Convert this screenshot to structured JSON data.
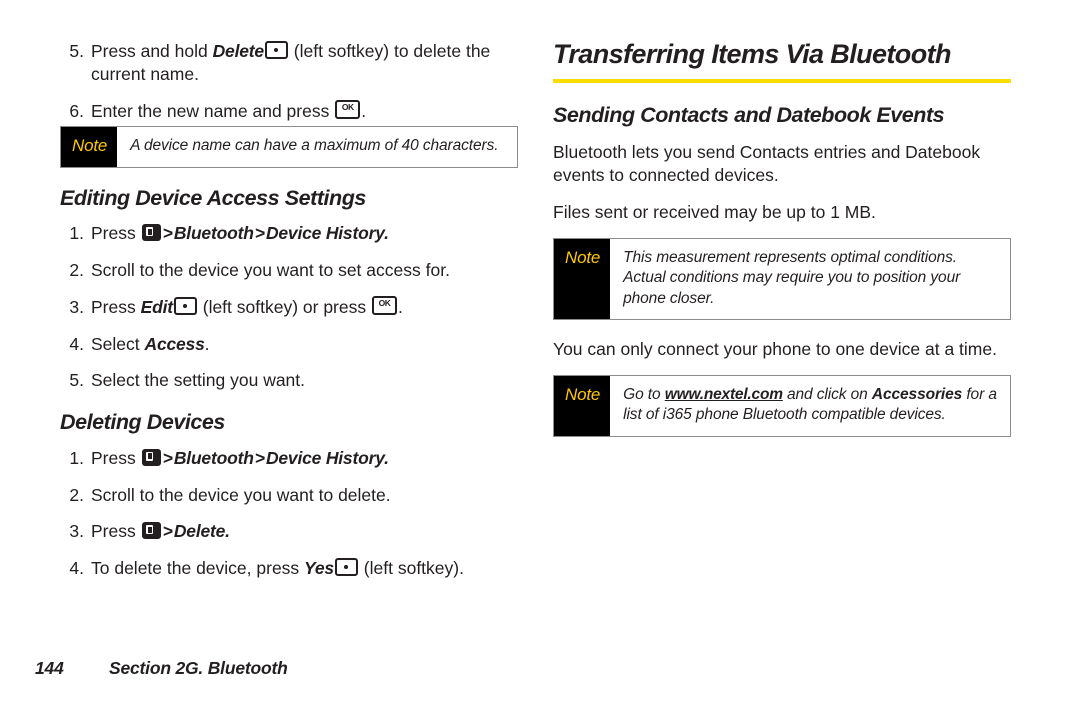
{
  "page": {
    "footer_page_number": "144",
    "footer_section": "Section 2G. Bluetooth"
  },
  "colors": {
    "accent_rule": "#FFDD00",
    "note_label_text": "#FFC800",
    "note_label_bg": "#000000",
    "body_text": "#231F20",
    "note_border": "#8C8C8C"
  },
  "icons": {
    "menu_key": "menu-key-icon",
    "ok_key": "ok-key-icon",
    "ok_key_label": "OK",
    "softkey": "left-softkey-icon"
  },
  "left_column": {
    "continued_steps": [
      {
        "number": "5.",
        "parts": [
          {
            "type": "text",
            "text": "Press and hold "
          },
          {
            "type": "bold-italic",
            "text": "Delete"
          },
          {
            "type": "icon",
            "icon": "softkey"
          },
          {
            "type": "text",
            "text": " (left softkey) to delete the current name."
          }
        ]
      },
      {
        "number": "6.",
        "parts": [
          {
            "type": "text",
            "text": "Enter the new name and press "
          },
          {
            "type": "icon",
            "icon": "ok_key"
          },
          {
            "type": "text",
            "text": "."
          }
        ]
      }
    ],
    "note_1": {
      "label": "Note",
      "text": "A device name can have a maximum of 40 characters."
    },
    "section_editing": {
      "heading": "Editing Device Access Settings",
      "steps": [
        {
          "number": "1.",
          "parts": [
            {
              "type": "text",
              "text": "Press "
            },
            {
              "type": "icon",
              "icon": "menu_key"
            },
            {
              "type": "sep",
              "text": ">"
            },
            {
              "type": "bold-italic",
              "text": "Bluetooth"
            },
            {
              "type": "sep",
              "text": ">"
            },
            {
              "type": "bold-italic",
              "text": "Device History."
            }
          ]
        },
        {
          "number": "2.",
          "parts": [
            {
              "type": "text",
              "text": "Scroll to the device you want to set access for."
            }
          ]
        },
        {
          "number": "3.",
          "parts": [
            {
              "type": "text",
              "text": "Press "
            },
            {
              "type": "bold-italic",
              "text": "Edit"
            },
            {
              "type": "icon",
              "icon": "softkey"
            },
            {
              "type": "text",
              "text": " (left softkey) or press "
            },
            {
              "type": "icon",
              "icon": "ok_key"
            },
            {
              "type": "text",
              "text": "."
            }
          ]
        },
        {
          "number": "4.",
          "parts": [
            {
              "type": "text",
              "text": "Select "
            },
            {
              "type": "bold-italic",
              "text": "Access"
            },
            {
              "type": "text",
              "text": "."
            }
          ]
        },
        {
          "number": "5.",
          "parts": [
            {
              "type": "text",
              "text": "Select the setting you want."
            }
          ]
        }
      ]
    },
    "section_deleting": {
      "heading": "Deleting Devices",
      "steps": [
        {
          "number": "1.",
          "parts": [
            {
              "type": "text",
              "text": "Press "
            },
            {
              "type": "icon",
              "icon": "menu_key"
            },
            {
              "type": "sep",
              "text": ">"
            },
            {
              "type": "bold-italic",
              "text": "Bluetooth"
            },
            {
              "type": "sep",
              "text": ">"
            },
            {
              "type": "bold-italic",
              "text": "Device History."
            }
          ]
        },
        {
          "number": "2.",
          "parts": [
            {
              "type": "text",
              "text": "Scroll to the device you want to delete."
            }
          ]
        },
        {
          "number": "3.",
          "parts": [
            {
              "type": "text",
              "text": "Press "
            },
            {
              "type": "icon",
              "icon": "menu_key"
            },
            {
              "type": "sep",
              "text": ">"
            },
            {
              "type": "bold-italic",
              "text": "Delete."
            }
          ]
        },
        {
          "number": "4.",
          "parts": [
            {
              "type": "text",
              "text": "To delete the device, press "
            },
            {
              "type": "bold-italic",
              "text": "Yes"
            },
            {
              "type": "icon",
              "icon": "softkey"
            },
            {
              "type": "text",
              "text": " (left softkey)."
            }
          ]
        }
      ]
    }
  },
  "right_column": {
    "title": "Transferring Items Via Bluetooth",
    "subheading": "Sending Contacts and Datebook Events",
    "paragraph_1": "Bluetooth lets you send Contacts entries and Datebook events to connected devices.",
    "paragraph_2": "Files sent or received may be up to 1 MB.",
    "note_1": {
      "label": "Note",
      "text": "This measurement represents optimal conditions. Actual conditions may require you to position your phone closer."
    },
    "paragraph_3": "You can only connect your phone to one device at a time.",
    "note_2": {
      "label": "Note",
      "parts": [
        {
          "type": "italic",
          "text": "Go to "
        },
        {
          "type": "bold-italic-underline",
          "text": "www.nextel.com"
        },
        {
          "type": "italic",
          "text": " and click on "
        },
        {
          "type": "bold",
          "text": "Accessories"
        },
        {
          "type": "italic",
          "text": " for a list of i365 phone Bluetooth compatible devices."
        }
      ]
    }
  }
}
